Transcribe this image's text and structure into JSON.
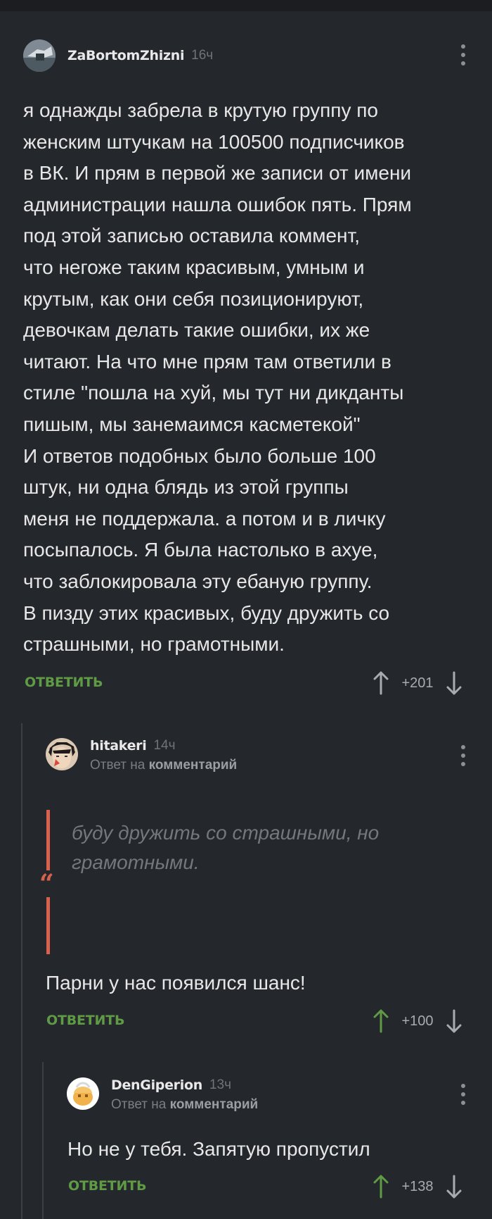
{
  "comments": [
    {
      "username": "ZaBortomZhizni",
      "time": "16ч",
      "text": "я однажды забрела в крутую группу по\nженским штучкам на 100500 подписчиков\nв ВК. И прям в первой же записи от имени\nадминистрации нашла ошибок пять. Прям\nпод этой записью оставила коммент,\nчто негоже таким красивым, умным и\nкрутым, как они себя позиционируют,\nдевочкам делать такие ошибки, их же\nчитают. На что мне прям там ответили в\nстиле \"пошла на хуй, мы тут ни дикданты\nпишым, мы занемаимся касметекой\"\nИ ответов подобных было больше 100\nштук, ни одна блядь из этой группы\nменя не поддержала. а потом и в личку\nпосыпалось. Я была настолько в ахуе,\nчто заблокировала эту ебаную группу.\nВ пизду этих красивых, буду дружить со\nстрашными, но грамотными.",
      "reply_label": "ОТВЕТИТЬ",
      "rating": "+201"
    },
    {
      "username": "hitakeri",
      "time": "14ч",
      "reply_prefix": "Ответ на",
      "reply_target": "комментарий",
      "quote": "буду дружить со страшными, но\nграмотными.",
      "text": "Парни у нас появился шанс!",
      "reply_label": "ОТВЕТИТЬ",
      "rating": "+100"
    },
    {
      "username": "DenGiperion",
      "time": "13ч",
      "reply_prefix": "Ответ на",
      "reply_target": "комментарий",
      "text": "Но не у тебя. Запятую пропустил",
      "reply_label": "ОТВЕТИТЬ",
      "rating": "+138"
    }
  ],
  "icons": {
    "more": "more-vertical-icon",
    "upvote": "arrow-up-icon",
    "downvote": "arrow-down-icon",
    "quote": "quote-icon"
  },
  "colors": {
    "background": "#24272b",
    "accent_green": "#5f9b45",
    "quote_red": "#d9614b"
  }
}
